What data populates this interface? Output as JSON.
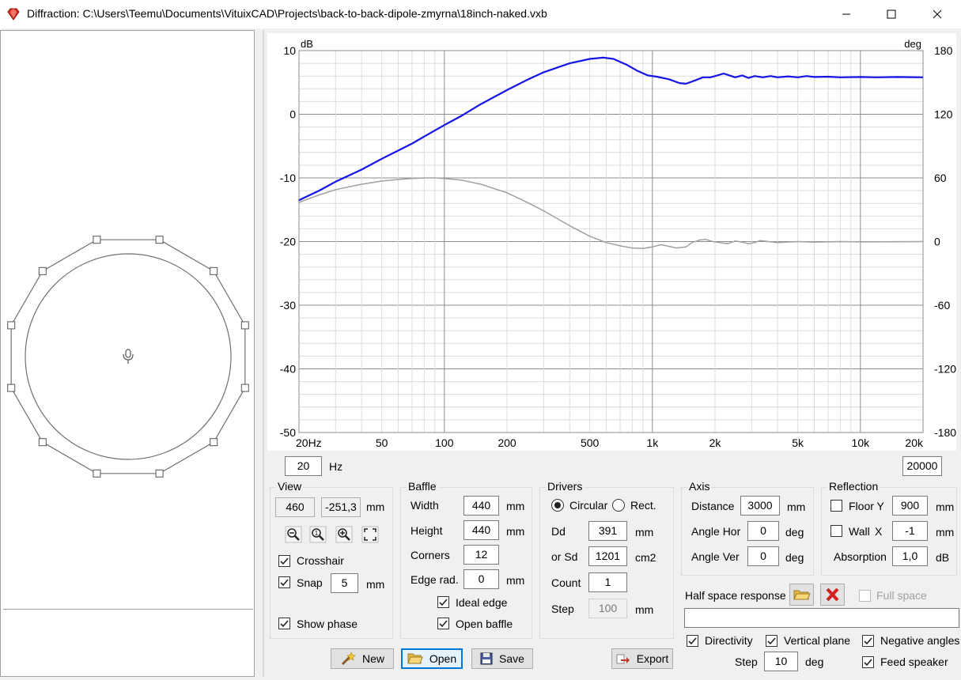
{
  "window": {
    "title": "Diffraction: C:\\Users\\Teemu\\Documents\\VituixCAD\\Projects\\back-to-back-dipole-zmyrna\\18inch-naked.vxb",
    "app_icon": "ruby-gem-icon",
    "controls": [
      "minimize-icon",
      "maximize-icon",
      "close-icon"
    ]
  },
  "chart_data": {
    "type": "line",
    "y_left_unit": "dB",
    "y_right_unit": "deg",
    "y_left_ticks": [
      "10",
      "0",
      "-10",
      "-20",
      "-30",
      "-40",
      "-50"
    ],
    "y_right_ticks": [
      "180",
      "120",
      "60",
      "0",
      "-60",
      "-120",
      "-180"
    ],
    "ylim_left": [
      -50,
      10
    ],
    "ylim_right": [
      -180,
      180
    ],
    "x_scale": "log",
    "xlim": [
      20,
      20000
    ],
    "x_tick_labels": [
      {
        "f": 20,
        "label": "20Hz"
      },
      {
        "f": 50,
        "label": "50"
      },
      {
        "f": 100,
        "label": "100"
      },
      {
        "f": 200,
        "label": "200"
      },
      {
        "f": 500,
        "label": "500"
      },
      {
        "f": 1000,
        "label": "1k"
      },
      {
        "f": 2000,
        "label": "2k"
      },
      {
        "f": 5000,
        "label": "5k"
      },
      {
        "f": 10000,
        "label": "10k"
      },
      {
        "f": 20000,
        "label": "20k"
      }
    ],
    "grid": true,
    "series": [
      {
        "axis": "left",
        "color": "#1414e6",
        "points": [
          [
            20,
            -13.5
          ],
          [
            25,
            -12
          ],
          [
            30,
            -10.6
          ],
          [
            40,
            -8.7
          ],
          [
            50,
            -7
          ],
          [
            60,
            -5.7
          ],
          [
            70,
            -4.6
          ],
          [
            80,
            -3.5
          ],
          [
            100,
            -1.7
          ],
          [
            120,
            -0.3
          ],
          [
            150,
            1.6
          ],
          [
            200,
            3.8
          ],
          [
            250,
            5.4
          ],
          [
            300,
            6.6
          ],
          [
            400,
            8
          ],
          [
            500,
            8.7
          ],
          [
            580,
            8.9
          ],
          [
            650,
            8.7
          ],
          [
            750,
            7.8
          ],
          [
            850,
            6.8
          ],
          [
            950,
            6.1
          ],
          [
            1050,
            5.9
          ],
          [
            1200,
            5.5
          ],
          [
            1350,
            4.9
          ],
          [
            1450,
            4.8
          ],
          [
            1600,
            5.3
          ],
          [
            1750,
            5.8
          ],
          [
            1900,
            5.8
          ],
          [
            2050,
            6.1
          ],
          [
            2200,
            6.4
          ],
          [
            2350,
            6.1
          ],
          [
            2500,
            5.8
          ],
          [
            2700,
            6.1
          ],
          [
            2900,
            5.7
          ],
          [
            3100,
            6.0
          ],
          [
            3400,
            5.8
          ],
          [
            3700,
            6.0
          ],
          [
            4000,
            5.8
          ],
          [
            4500,
            5.95
          ],
          [
            5000,
            5.8
          ],
          [
            5500,
            6.0
          ],
          [
            6000,
            5.85
          ],
          [
            7000,
            5.9
          ],
          [
            8000,
            5.8
          ],
          [
            10000,
            5.85
          ],
          [
            12000,
            5.8
          ],
          [
            15000,
            5.85
          ],
          [
            20000,
            5.8
          ]
        ]
      },
      {
        "axis": "right",
        "color": "#a0a0a0",
        "points": [
          [
            20,
            37
          ],
          [
            25,
            44
          ],
          [
            30,
            49
          ],
          [
            40,
            54
          ],
          [
            50,
            57
          ],
          [
            60,
            58.5
          ],
          [
            70,
            59.5
          ],
          [
            80,
            60
          ],
          [
            90,
            60
          ],
          [
            100,
            59.5
          ],
          [
            120,
            58
          ],
          [
            150,
            54
          ],
          [
            200,
            46
          ],
          [
            250,
            37
          ],
          [
            300,
            29
          ],
          [
            400,
            15
          ],
          [
            500,
            5
          ],
          [
            600,
            -1
          ],
          [
            700,
            -4
          ],
          [
            800,
            -6
          ],
          [
            900,
            -6.5
          ],
          [
            1000,
            -5
          ],
          [
            1100,
            -3
          ],
          [
            1200,
            -4.5
          ],
          [
            1300,
            -6
          ],
          [
            1450,
            -5
          ],
          [
            1550,
            -1
          ],
          [
            1700,
            1.5
          ],
          [
            1800,
            2
          ],
          [
            1950,
            0
          ],
          [
            2100,
            -1
          ],
          [
            2300,
            -2
          ],
          [
            2500,
            0.5
          ],
          [
            2700,
            -0.5
          ],
          [
            2900,
            -2
          ],
          [
            3100,
            -1
          ],
          [
            3300,
            1
          ],
          [
            3600,
            0
          ],
          [
            4000,
            -1
          ],
          [
            5000,
            0
          ],
          [
            6000,
            -0.5
          ],
          [
            8000,
            0
          ],
          [
            10000,
            -0.3
          ],
          [
            20000,
            0
          ]
        ]
      }
    ]
  },
  "freq": {
    "min": "20",
    "min_unit": "Hz",
    "max": "20000"
  },
  "baffle_view": {
    "corners": 12,
    "mic_icon": "microphone-icon"
  },
  "view": {
    "title": "View",
    "x": "460",
    "y": "-251,3",
    "unit": "mm",
    "tools": [
      "zoom-out-icon",
      "zoom-reset-icon",
      "zoom-in-icon",
      "zoom-fit-icon"
    ],
    "crosshair_label": "Crosshair",
    "crosshair_checked": true,
    "snap_label": "Snap",
    "snap_checked": true,
    "snap_value": "5",
    "snap_unit": "mm",
    "show_phase_label": "Show phase",
    "show_phase_checked": true
  },
  "baffle": {
    "title": "Baffle",
    "width_label": "Width",
    "width": "440",
    "width_unit": "mm",
    "height_label": "Height",
    "height": "440",
    "height_unit": "mm",
    "corners_label": "Corners",
    "corners": "12",
    "edge_label": "Edge rad.",
    "edge": "0",
    "edge_unit": "mm",
    "ideal_edge_label": "Ideal edge",
    "ideal_edge_checked": true,
    "open_baffle_label": "Open baffle",
    "open_baffle_checked": true
  },
  "drivers": {
    "title": "Drivers",
    "circular_label": "Circular",
    "rect_label": "Rect.",
    "selected": "circular",
    "dd_label": "Dd",
    "dd": "391",
    "dd_unit": "mm",
    "sd_label": "or Sd",
    "sd": "1201",
    "sd_unit": "cm2",
    "count_label": "Count",
    "count": "1",
    "step_label": "Step",
    "step": "100",
    "step_unit": "mm"
  },
  "axis": {
    "title": "Axis",
    "distance_label": "Distance",
    "distance": "3000",
    "distance_unit": "mm",
    "angle_hor_label": "Angle Hor",
    "angle_hor": "0",
    "angle_hor_unit": "deg",
    "angle_ver_label": "Angle Ver",
    "angle_ver": "0",
    "angle_ver_unit": "deg"
  },
  "reflection": {
    "title": "Reflection",
    "floor_label": "Floor Y",
    "floor_checked": false,
    "floor": "900",
    "floor_unit": "mm",
    "wall_label": "Wall",
    "wall_axis": "X",
    "wall_checked": false,
    "wall": "-1",
    "wall_unit": "mm",
    "absorption_label": "Absorption",
    "absorption": "1,0",
    "absorption_unit": "dB"
  },
  "half_space": {
    "label": "Half space response",
    "open_icon": "folder-open-icon",
    "clear_icon": "red-x-icon",
    "full_space_label": "Full space",
    "full_space_checked": false,
    "path": ""
  },
  "options": {
    "directivity_label": "Directivity",
    "directivity_checked": true,
    "vertical_plane_label": "Vertical plane",
    "vertical_plane_checked": true,
    "negative_angles_label": "Negative angles",
    "negative_angles_checked": true,
    "feed_speaker_label": "Feed speaker",
    "feed_speaker_checked": true,
    "step_label": "Step",
    "step": "10",
    "step_unit": "deg"
  },
  "buttons": {
    "new": "New",
    "new_icon": "magic-wand-icon",
    "open": "Open",
    "open_icon": "folder-open-icon",
    "save": "Save",
    "save_icon": "floppy-disk-icon",
    "export": "Export",
    "export_icon": "export-arrow-icon"
  }
}
